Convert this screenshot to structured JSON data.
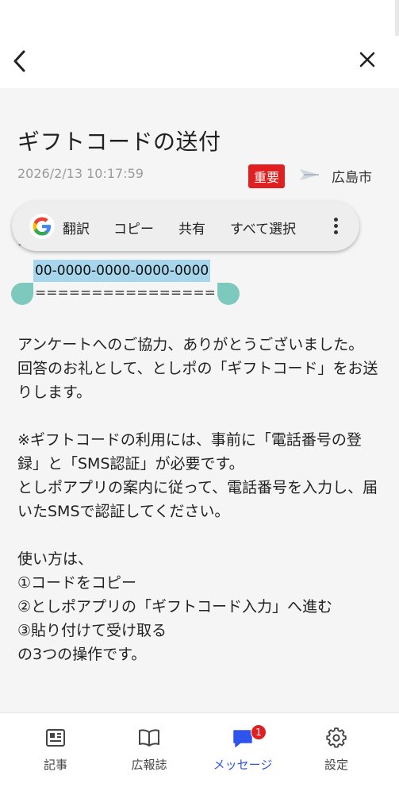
{
  "header": {
    "back_icon": "chevron-left-icon",
    "close_icon": "close-icon"
  },
  "article": {
    "title": "ギフトコードの送付",
    "date": "2026/2/13 10:17:59",
    "badge": "重要",
    "sender_icon": "paper-plane-icon",
    "sender": "広島市"
  },
  "context_menu": {
    "logo_icon": "google-g-icon",
    "items": [
      "翻訳",
      "コピー",
      "共有",
      "すべて選択"
    ],
    "more_icon": "more-vertical-icon"
  },
  "code": {
    "partial_line": "=",
    "selected_text": "00-0000-0000-0000-0000",
    "separator": "================"
  },
  "body_paragraphs": [
    "アンケートへのご協力、ありがとうございました。",
    "回答のお礼として、としポの「ギフトコード」をお送りします。",
    "",
    "※ギフトコードの利用には、事前に「電話番号の登録」と「SMS認証」が必要です。",
    "としポアプリの案内に従って、電話番号を入力し、届いたSMSで認証してください。",
    "",
    "使い方は、",
    "①コードをコピー",
    "②としポアプリの「ギフトコード入力」へ進む",
    "③貼り付けて受け取る",
    "の3つの操作です。"
  ],
  "tabs": [
    {
      "label": "記事",
      "icon": "newspaper-icon"
    },
    {
      "label": "広報誌",
      "icon": "book-icon"
    },
    {
      "label": "メッセージ",
      "icon": "chat-bubble-icon",
      "badge": "1",
      "active": true
    },
    {
      "label": "設定",
      "icon": "gear-icon"
    }
  ],
  "colors": {
    "accent": "#2f54eb",
    "badge_red": "#e02020",
    "selection": "#a7d6ec",
    "handle": "#7ec9bd"
  }
}
